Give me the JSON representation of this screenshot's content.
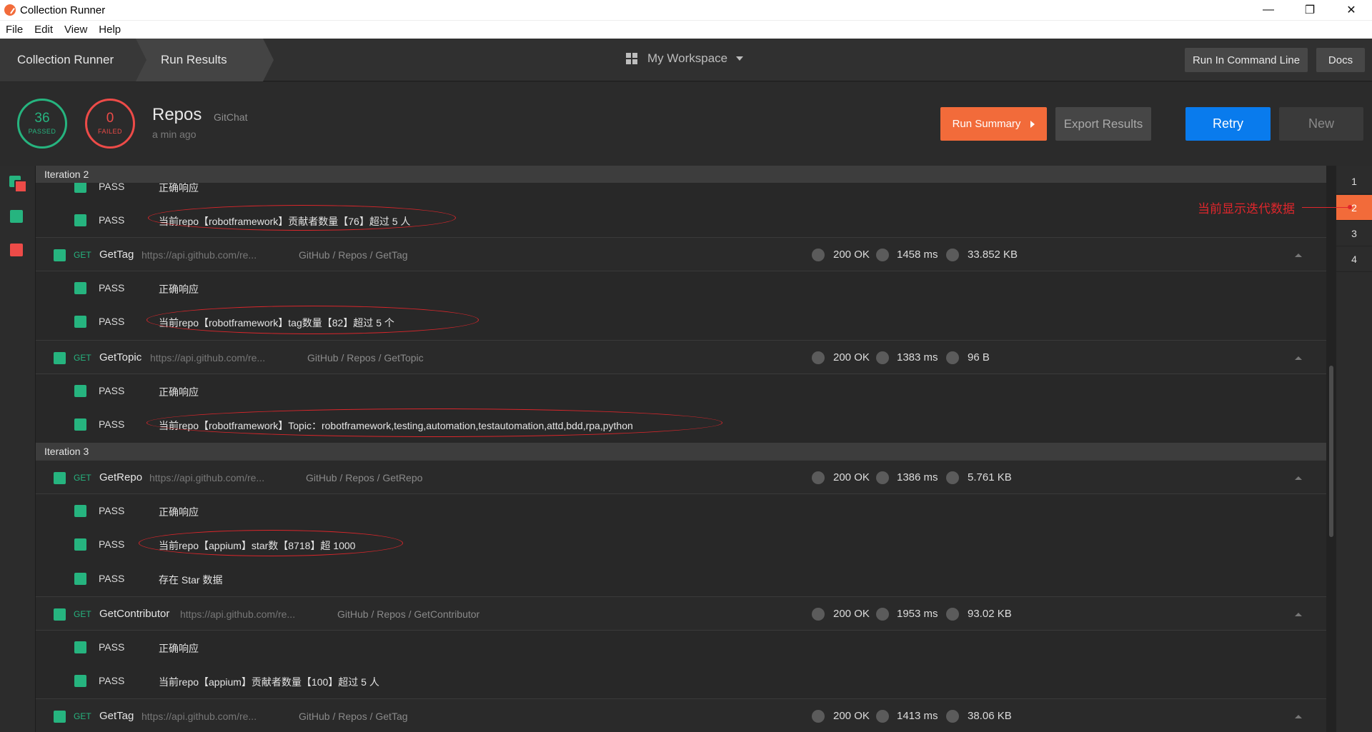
{
  "window": {
    "title": "Collection Runner"
  },
  "menu": [
    "File",
    "Edit",
    "View",
    "Help"
  ],
  "header": {
    "breadcrumb": [
      "Collection Runner",
      "Run Results"
    ],
    "workspace": "My Workspace",
    "run_cmd_label": "Run In Command Line",
    "docs_label": "Docs"
  },
  "summary": {
    "passed_count": "36",
    "passed_label": "PASSED",
    "failed_count": "0",
    "failed_label": "FAILED",
    "run_name": "Repos",
    "collection": "GitChat",
    "time": "a min ago",
    "run_summary_label": "Run Summary",
    "export_label": "Export Results",
    "retry_label": "Retry",
    "new_label": "New"
  },
  "iterations": [
    {
      "label": "Iteration 2"
    },
    {
      "label": "Iteration 3"
    }
  ],
  "pass_label": "PASS",
  "requests": [
    {
      "method": "GET",
      "name": "GetTag",
      "url": "https://api.github.com/re...",
      "path": "GitHub / Repos / GetTag",
      "status": "200 OK",
      "time": "1458 ms",
      "size": "33.852 KB"
    },
    {
      "method": "GET",
      "name": "GetTopic",
      "url": "https://api.github.com/re...",
      "path": "GitHub / Repos / GetTopic",
      "status": "200 OK",
      "time": "1383 ms",
      "size": "96 B"
    },
    {
      "method": "GET",
      "name": "GetRepo",
      "url": "https://api.github.com/re...",
      "path": "GitHub / Repos / GetRepo",
      "status": "200 OK",
      "time": "1386 ms",
      "size": "5.761 KB"
    },
    {
      "method": "GET",
      "name": "GetContributor",
      "url": "https://api.github.com/re...",
      "path": "GitHub / Repos / GetContributor",
      "status": "200 OK",
      "time": "1953 ms",
      "size": "93.02 KB"
    },
    {
      "method": "GET",
      "name": "GetTag",
      "url": "https://api.github.com/re...",
      "path": "GitHub / Repos / GetTag",
      "status": "200 OK",
      "time": "1413 ms",
      "size": "38.06 KB"
    }
  ],
  "tests": [
    "正确响应",
    "当前repo【robotframework】贡献者数量【76】超过 5 人",
    "正确响应",
    "当前repo【robotframework】tag数量【82】超过 5 个",
    "正确响应",
    "当前repo【robotframework】Topic：robotframework,testing,automation,testautomation,attd,bdd,rpa,python",
    "正确响应",
    "当前repo【appium】star数【8718】超 1000",
    "存在 Star 数据",
    "正确响应",
    "当前repo【appium】贡献者数量【100】超过 5 人"
  ],
  "pager": [
    "1",
    "2",
    "3",
    "4"
  ],
  "annotation": "当前显示迭代数据",
  "colors": {
    "pass": "#26b47f",
    "fail": "#ed4b48",
    "accent": "#f26b3a",
    "primary": "#097bed"
  }
}
